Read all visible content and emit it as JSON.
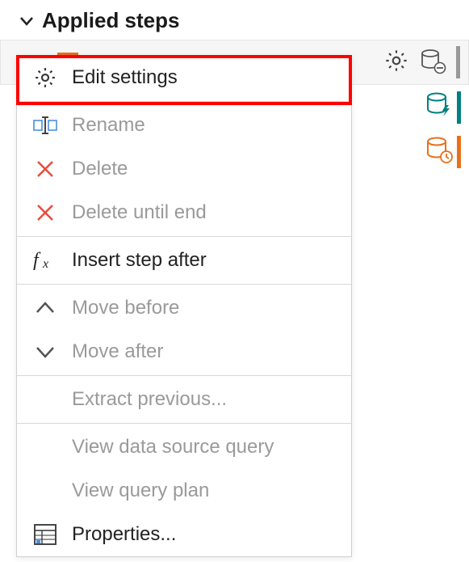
{
  "panel": {
    "title": "Applied steps"
  },
  "context_menu": {
    "edit_settings": "Edit settings",
    "rename": "Rename",
    "delete": "Delete",
    "delete_until_end": "Delete until end",
    "insert_step_after": "Insert step after",
    "move_before": "Move before",
    "move_after": "Move after",
    "extract_previous": "Extract previous...",
    "view_data_source_query": "View data source query",
    "view_query_plan": "View query plan",
    "properties": "Properties..."
  },
  "colors": {
    "highlight": "#ff0000",
    "disabled_text": "#9a9a9a",
    "delete_x": "#e74c3c",
    "teal_accent": "#008080",
    "orange_accent": "#e8701b"
  }
}
